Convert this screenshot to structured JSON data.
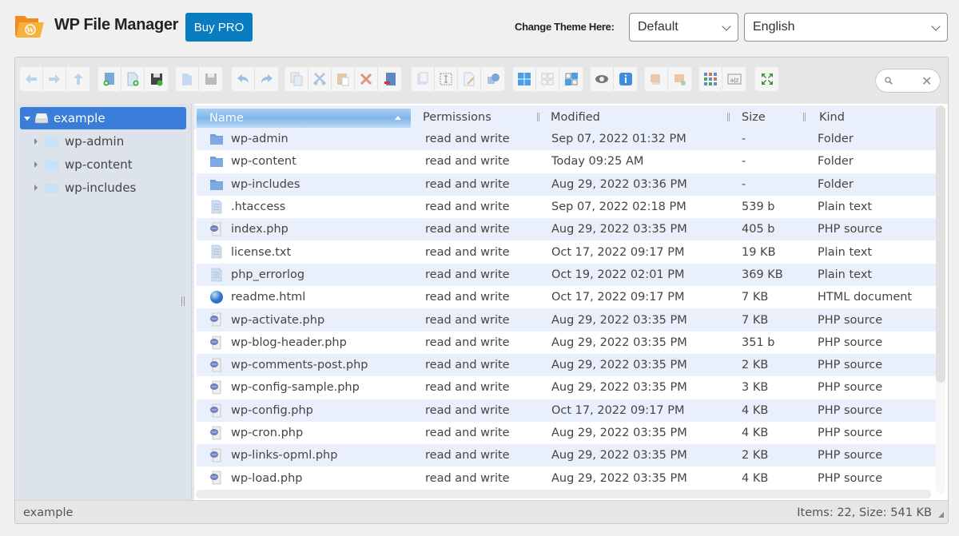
{
  "header": {
    "app_title": "WP File Manager",
    "buy_pro_label": "Buy PRO",
    "theme_label": "Change Theme Here:",
    "theme_select": "Default",
    "language_select": "English"
  },
  "colors": {
    "brand_orange": "#f7a534",
    "button_blue": "#0a7cc0",
    "selection_blue": "#3a7dd8",
    "row_alt": "#eaf0fb"
  },
  "toolbar": {
    "groups": [
      [
        "back-icon",
        "forward-icon",
        "up-icon"
      ],
      [
        "new-folder-icon",
        "new-file-icon",
        "upload-icon"
      ],
      [
        "open-icon",
        "download-icon"
      ],
      [
        "undo-icon",
        "redo-icon"
      ],
      [
        "copy-icon",
        "cut-icon",
        "paste-icon",
        "delete-icon",
        "empty-icon"
      ],
      [
        "duplicate-icon",
        "rename-icon",
        "edit-icon",
        "resize-icon"
      ],
      [
        "select-all-icon",
        "select-none-icon",
        "invert-selection-icon"
      ],
      [
        "preview-icon",
        "info-icon"
      ],
      [
        "extract-icon",
        "archive-icon"
      ],
      [
        "view-icon",
        "sort-icon"
      ],
      [
        "fullscreen-icon"
      ]
    ],
    "search_placeholder": ""
  },
  "tree": {
    "root": "example",
    "children": [
      "wp-admin",
      "wp-content",
      "wp-includes"
    ]
  },
  "list": {
    "columns": [
      "Name",
      "Permissions",
      "Modified",
      "Size",
      "Kind"
    ],
    "rows": [
      {
        "icon": "folder",
        "name": "wp-admin",
        "perm": "read and write",
        "modified": "Sep 07, 2022 01:32 PM",
        "size": "-",
        "kind": "Folder"
      },
      {
        "icon": "folder",
        "name": "wp-content",
        "perm": "read and write",
        "modified": "Today 09:25 AM",
        "size": "-",
        "kind": "Folder"
      },
      {
        "icon": "folder",
        "name": "wp-includes",
        "perm": "read and write",
        "modified": "Aug 29, 2022 03:36 PM",
        "size": "-",
        "kind": "Folder"
      },
      {
        "icon": "text",
        "name": ".htaccess",
        "perm": "read and write",
        "modified": "Sep 07, 2022 02:18 PM",
        "size": "539 b",
        "kind": "Plain text"
      },
      {
        "icon": "php",
        "name": "index.php",
        "perm": "read and write",
        "modified": "Aug 29, 2022 03:35 PM",
        "size": "405 b",
        "kind": "PHP source"
      },
      {
        "icon": "text",
        "name": "license.txt",
        "perm": "read and write",
        "modified": "Oct 17, 2022 09:17 PM",
        "size": "19 KB",
        "kind": "Plain text"
      },
      {
        "icon": "text",
        "name": "php_errorlog",
        "perm": "read and write",
        "modified": "Oct 19, 2022 02:01 PM",
        "size": "369 KB",
        "kind": "Plain text"
      },
      {
        "icon": "html",
        "name": "readme.html",
        "perm": "read and write",
        "modified": "Oct 17, 2022 09:17 PM",
        "size": "7 KB",
        "kind": "HTML document"
      },
      {
        "icon": "php",
        "name": "wp-activate.php",
        "perm": "read and write",
        "modified": "Aug 29, 2022 03:35 PM",
        "size": "7 KB",
        "kind": "PHP source"
      },
      {
        "icon": "php",
        "name": "wp-blog-header.php",
        "perm": "read and write",
        "modified": "Aug 29, 2022 03:35 PM",
        "size": "351 b",
        "kind": "PHP source"
      },
      {
        "icon": "php",
        "name": "wp-comments-post.php",
        "perm": "read and write",
        "modified": "Aug 29, 2022 03:35 PM",
        "size": "2 KB",
        "kind": "PHP source"
      },
      {
        "icon": "php",
        "name": "wp-config-sample.php",
        "perm": "read and write",
        "modified": "Aug 29, 2022 03:35 PM",
        "size": "3 KB",
        "kind": "PHP source"
      },
      {
        "icon": "php",
        "name": "wp-config.php",
        "perm": "read and write",
        "modified": "Oct 17, 2022 09:17 PM",
        "size": "4 KB",
        "kind": "PHP source"
      },
      {
        "icon": "php",
        "name": "wp-cron.php",
        "perm": "read and write",
        "modified": "Aug 29, 2022 03:35 PM",
        "size": "4 KB",
        "kind": "PHP source"
      },
      {
        "icon": "php",
        "name": "wp-links-opml.php",
        "perm": "read and write",
        "modified": "Aug 29, 2022 03:35 PM",
        "size": "2 KB",
        "kind": "PHP source"
      },
      {
        "icon": "php",
        "name": "wp-load.php",
        "perm": "read and write",
        "modified": "Aug 29, 2022 03:35 PM",
        "size": "4 KB",
        "kind": "PHP source"
      }
    ]
  },
  "status": {
    "path": "example",
    "info": "Items: 22, Size: 541 KB"
  }
}
